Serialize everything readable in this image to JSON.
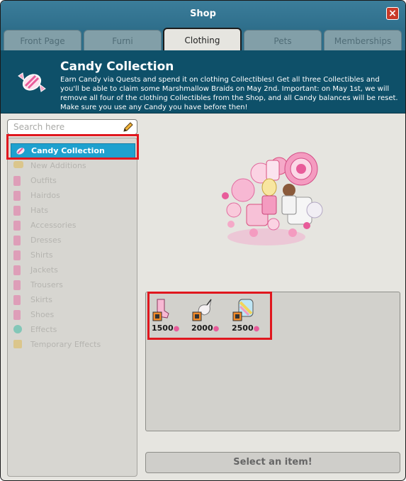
{
  "window": {
    "title": "Shop"
  },
  "tabs": [
    {
      "label": "Front Page"
    },
    {
      "label": "Furni"
    },
    {
      "label": "Clothing"
    },
    {
      "label": "Pets"
    },
    {
      "label": "Memberships"
    }
  ],
  "banner": {
    "title": "Candy Collection",
    "description": "Earn Candy via Quests and spend it on clothing Collectibles! Get all three Collectibles and you'll be able to claim some Marshmallow Braids on May 2nd. Important: on May 1st, we will remove all four of the clothing Collectibles from the Shop, and all Candy balances will be reset. Make sure you use any Candy you have before then!"
  },
  "search": {
    "placeholder": "Search here"
  },
  "categories": [
    {
      "label": "Candy Collection",
      "icon": "candy-icon",
      "color": "#e85c9a"
    },
    {
      "label": "New Additions",
      "icon": "new-icon",
      "color": "#e0b43a"
    },
    {
      "label": "Outfits",
      "icon": "outfit-icon",
      "color": "#e85c9a"
    },
    {
      "label": "Hairdos",
      "icon": "hair-icon",
      "color": "#e85c9a"
    },
    {
      "label": "Hats",
      "icon": "hat-icon",
      "color": "#e85c9a"
    },
    {
      "label": "Accessories",
      "icon": "accessory-icon",
      "color": "#e85c9a"
    },
    {
      "label": "Dresses",
      "icon": "dress-icon",
      "color": "#e85c9a"
    },
    {
      "label": "Shirts",
      "icon": "shirt-icon",
      "color": "#e85c9a"
    },
    {
      "label": "Jackets",
      "icon": "jacket-icon",
      "color": "#e85c9a"
    },
    {
      "label": "Trousers",
      "icon": "trousers-icon",
      "color": "#e85c9a"
    },
    {
      "label": "Skirts",
      "icon": "skirt-icon",
      "color": "#e85c9a"
    },
    {
      "label": "Shoes",
      "icon": "shoes-icon",
      "color": "#e85c9a"
    },
    {
      "label": "Effects",
      "icon": "effects-icon",
      "color": "#1fb59b"
    },
    {
      "label": "Temporary Effects",
      "icon": "temp-effects-icon",
      "color": "#e0b43a"
    }
  ],
  "items": [
    {
      "price": "1500",
      "icon": "socks-collectible-icon",
      "currency_icon": "candy-icon"
    },
    {
      "price": "2000",
      "icon": "unicorn-collectible-icon",
      "currency_icon": "candy-icon"
    },
    {
      "price": "2500",
      "icon": "backpack-collectible-icon",
      "currency_icon": "candy-icon"
    }
  ],
  "select_button": {
    "label": "Select an item!"
  },
  "colors": {
    "accent": "#1ea1cf",
    "banner": "#0e5069",
    "titlebar": "#2f6f8c",
    "highlight": "#e0171e"
  }
}
